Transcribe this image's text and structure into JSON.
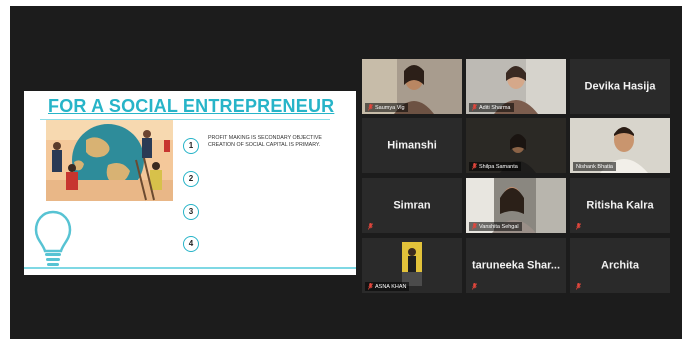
{
  "slide": {
    "title": "FOR A SOCIAL ENTREPRENEUR",
    "steps": [
      "1",
      "2",
      "3",
      "4"
    ],
    "objective": "PROFIT MAKING IS SECONDARY OBJECTIVE CREATION OF SOCIAL CAPITAL IS PRIMARY."
  },
  "participants": {
    "saumya": "Saumya Vig",
    "aditi": "Aditi Sharma",
    "devika": "Devika Hasija",
    "himanshi": "Himanshi",
    "shilpa": "Shilpa Samanta",
    "nishank": "Nishank Bhatia",
    "simran": "Simran",
    "vanshita": "Vanshita Sehgal",
    "ritisha": "Ritisha Kalra",
    "asna": "ASNA KHAN",
    "taruneeka": "taruneeka  Shar...",
    "archita": "Archita"
  },
  "colors": {
    "accent": "#27b4c8",
    "tile_bg": "#2a2a2a",
    "window_bg": "#1c1c1c",
    "active_speaker": "#8fd14f",
    "muted_mic": "#e0463c"
  },
  "icons": [
    "muted-mic-icon",
    "lightbulb-icon"
  ]
}
